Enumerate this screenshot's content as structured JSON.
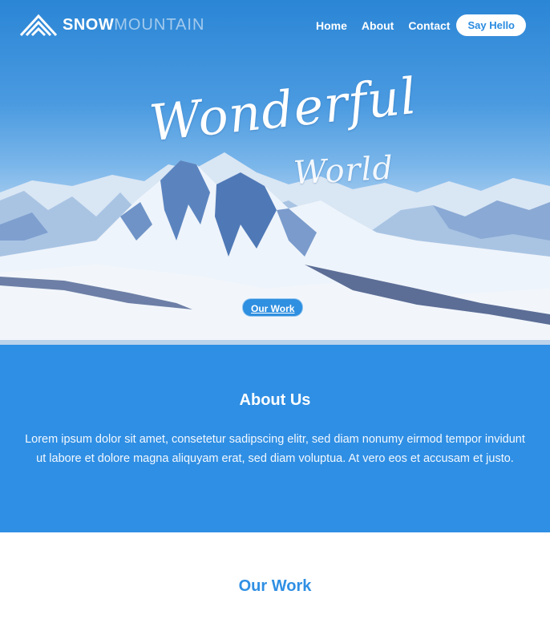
{
  "nav": {
    "logo_bold": "SNOW",
    "logo_light": "MOUNTAIN",
    "links": [
      "Home",
      "About",
      "Contact"
    ],
    "cta": "Say Hello"
  },
  "hero": {
    "title_line1": "Wonderful",
    "title_line2": "World",
    "button": "Our Work"
  },
  "about": {
    "heading": "About Us",
    "body": "Lorem ipsum dolor sit amet, consetetur sadipscing elitr, sed diam nonumy eirmod tempor invidunt ut labore et dolore magna aliquyam erat, sed diam voluptua. At vero eos et accusam et justo."
  },
  "work": {
    "heading": "Our Work"
  },
  "colors": {
    "brand_blue": "#2f8fe4",
    "white": "#ffffff"
  }
}
